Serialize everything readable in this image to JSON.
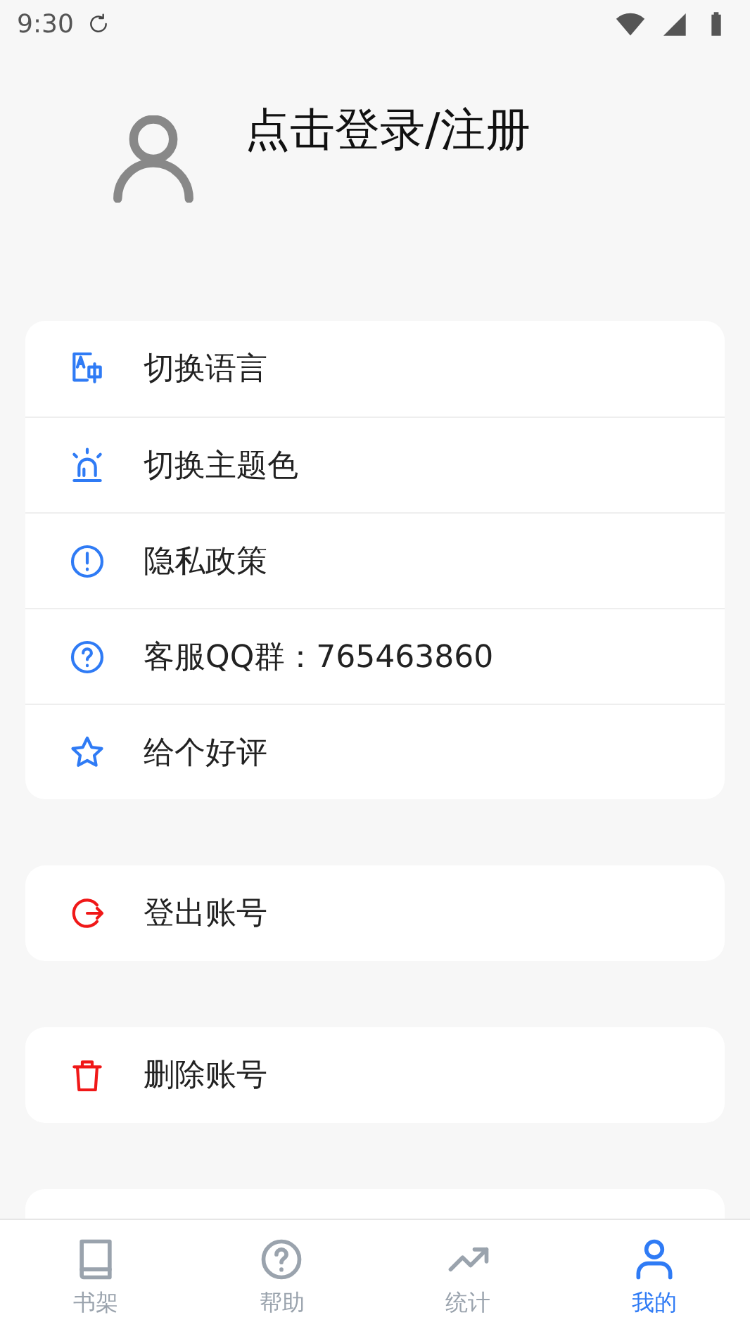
{
  "status_bar": {
    "time": "9:30"
  },
  "profile": {
    "login_label": "点击登录/注册"
  },
  "sections": [
    {
      "items": [
        {
          "label": "切换语言",
          "kind": "normal"
        },
        {
          "label": "切换主题色",
          "kind": "normal"
        },
        {
          "label": "隐私政策",
          "kind": "normal"
        },
        {
          "label": "客服QQ群：765463860",
          "kind": "normal"
        },
        {
          "label": "给个好评",
          "kind": "normal"
        }
      ]
    },
    {
      "items": [
        {
          "label": "登出账号",
          "kind": "danger"
        }
      ]
    },
    {
      "items": [
        {
          "label": "删除账号",
          "kind": "danger"
        }
      ]
    }
  ],
  "bottom_nav": [
    {
      "label": "书架",
      "selected": false
    },
    {
      "label": "帮助",
      "selected": false
    },
    {
      "label": "统计",
      "selected": false
    },
    {
      "label": "我的",
      "selected": true
    }
  ]
}
